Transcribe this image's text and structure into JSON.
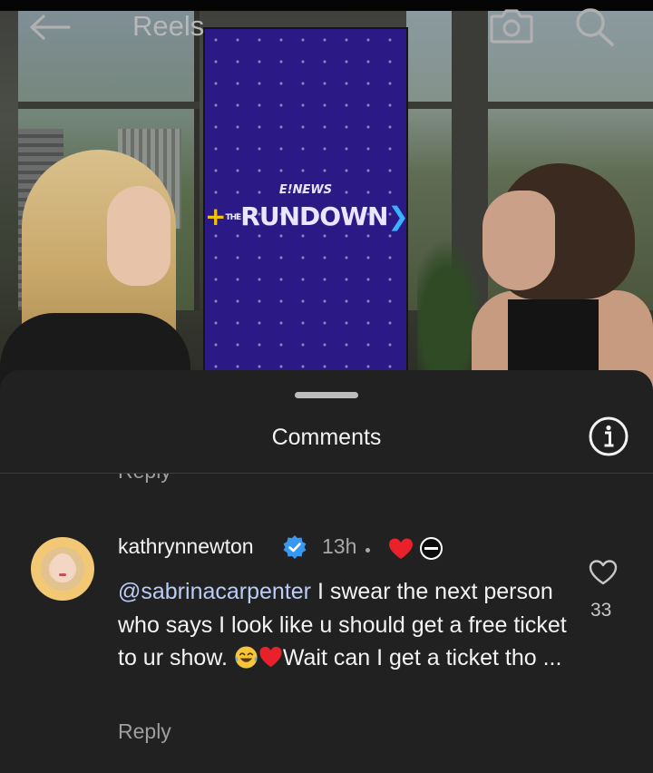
{
  "header": {
    "title": "Reels"
  },
  "video": {
    "banner_small_text": "E!NEWS",
    "banner_prefix": "THE",
    "banner_main_text": "RUNDOWN"
  },
  "comments_sheet": {
    "title": "Comments",
    "previous_reply_label": "Reply",
    "comment": {
      "username": "kathrynnewton",
      "verified": true,
      "timestamp": "13h",
      "liked_by_creator": true,
      "mention": "@sabrinacarpenter",
      "text": " I swear the next person who says I look like u should get a free ticket to ur show. ",
      "emoji_1": "face-with-tears-of-joy",
      "emoji_2": "red-heart",
      "text_tail": "Wait can I get a ticket tho ...",
      "reply_label": "Reply",
      "like_count": "33"
    }
  },
  "colors": {
    "sheet_background": "#212121",
    "mention": "#b9cdf6",
    "verified_badge": "#3897f0",
    "heart_red": "#e8212b",
    "banner_purple": "#2b1a86"
  }
}
